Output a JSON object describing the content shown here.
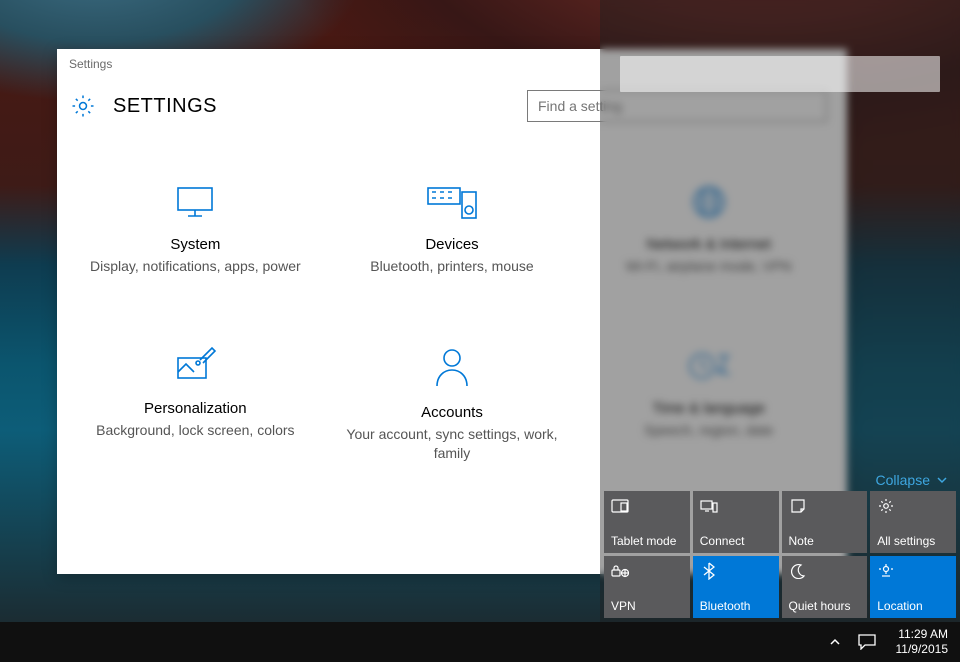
{
  "settings": {
    "window_title": "Settings",
    "page_heading": "SETTINGS",
    "search_placeholder": "Find a setting",
    "accent_color": "#0078d7",
    "categories": [
      {
        "id": "system",
        "title": "System",
        "sub": "Display, notifications, apps, power"
      },
      {
        "id": "devices",
        "title": "Devices",
        "sub": "Bluetooth, printers, mouse"
      },
      {
        "id": "network",
        "title": "Network & Internet",
        "sub": "Wi-Fi, airplane mode, VPN"
      },
      {
        "id": "personalization",
        "title": "Personalization",
        "sub": "Background, lock screen, colors"
      },
      {
        "id": "accounts",
        "title": "Accounts",
        "sub": "Your account, sync settings, work, family"
      },
      {
        "id": "time",
        "title": "Time & language",
        "sub": "Speech, region, date"
      }
    ]
  },
  "action_center": {
    "collapse_label": "Collapse",
    "tiles": [
      {
        "id": "tablet-mode",
        "label": "Tablet mode",
        "icon": "tablet-icon",
        "active": false
      },
      {
        "id": "connect",
        "label": "Connect",
        "icon": "connect-icon",
        "active": false
      },
      {
        "id": "note",
        "label": "Note",
        "icon": "note-icon",
        "active": false
      },
      {
        "id": "all-settings",
        "label": "All settings",
        "icon": "gear-icon",
        "active": false
      },
      {
        "id": "vpn",
        "label": "VPN",
        "icon": "vpn-icon",
        "active": false
      },
      {
        "id": "bluetooth",
        "label": "Bluetooth",
        "icon": "bluetooth-icon",
        "active": true
      },
      {
        "id": "quiet-hours",
        "label": "Quiet hours",
        "icon": "moon-icon",
        "active": false
      },
      {
        "id": "location",
        "label": "Location",
        "icon": "location-icon",
        "active": true
      }
    ]
  },
  "taskbar": {
    "time": "11:29 AM",
    "date": "11/9/2015"
  }
}
